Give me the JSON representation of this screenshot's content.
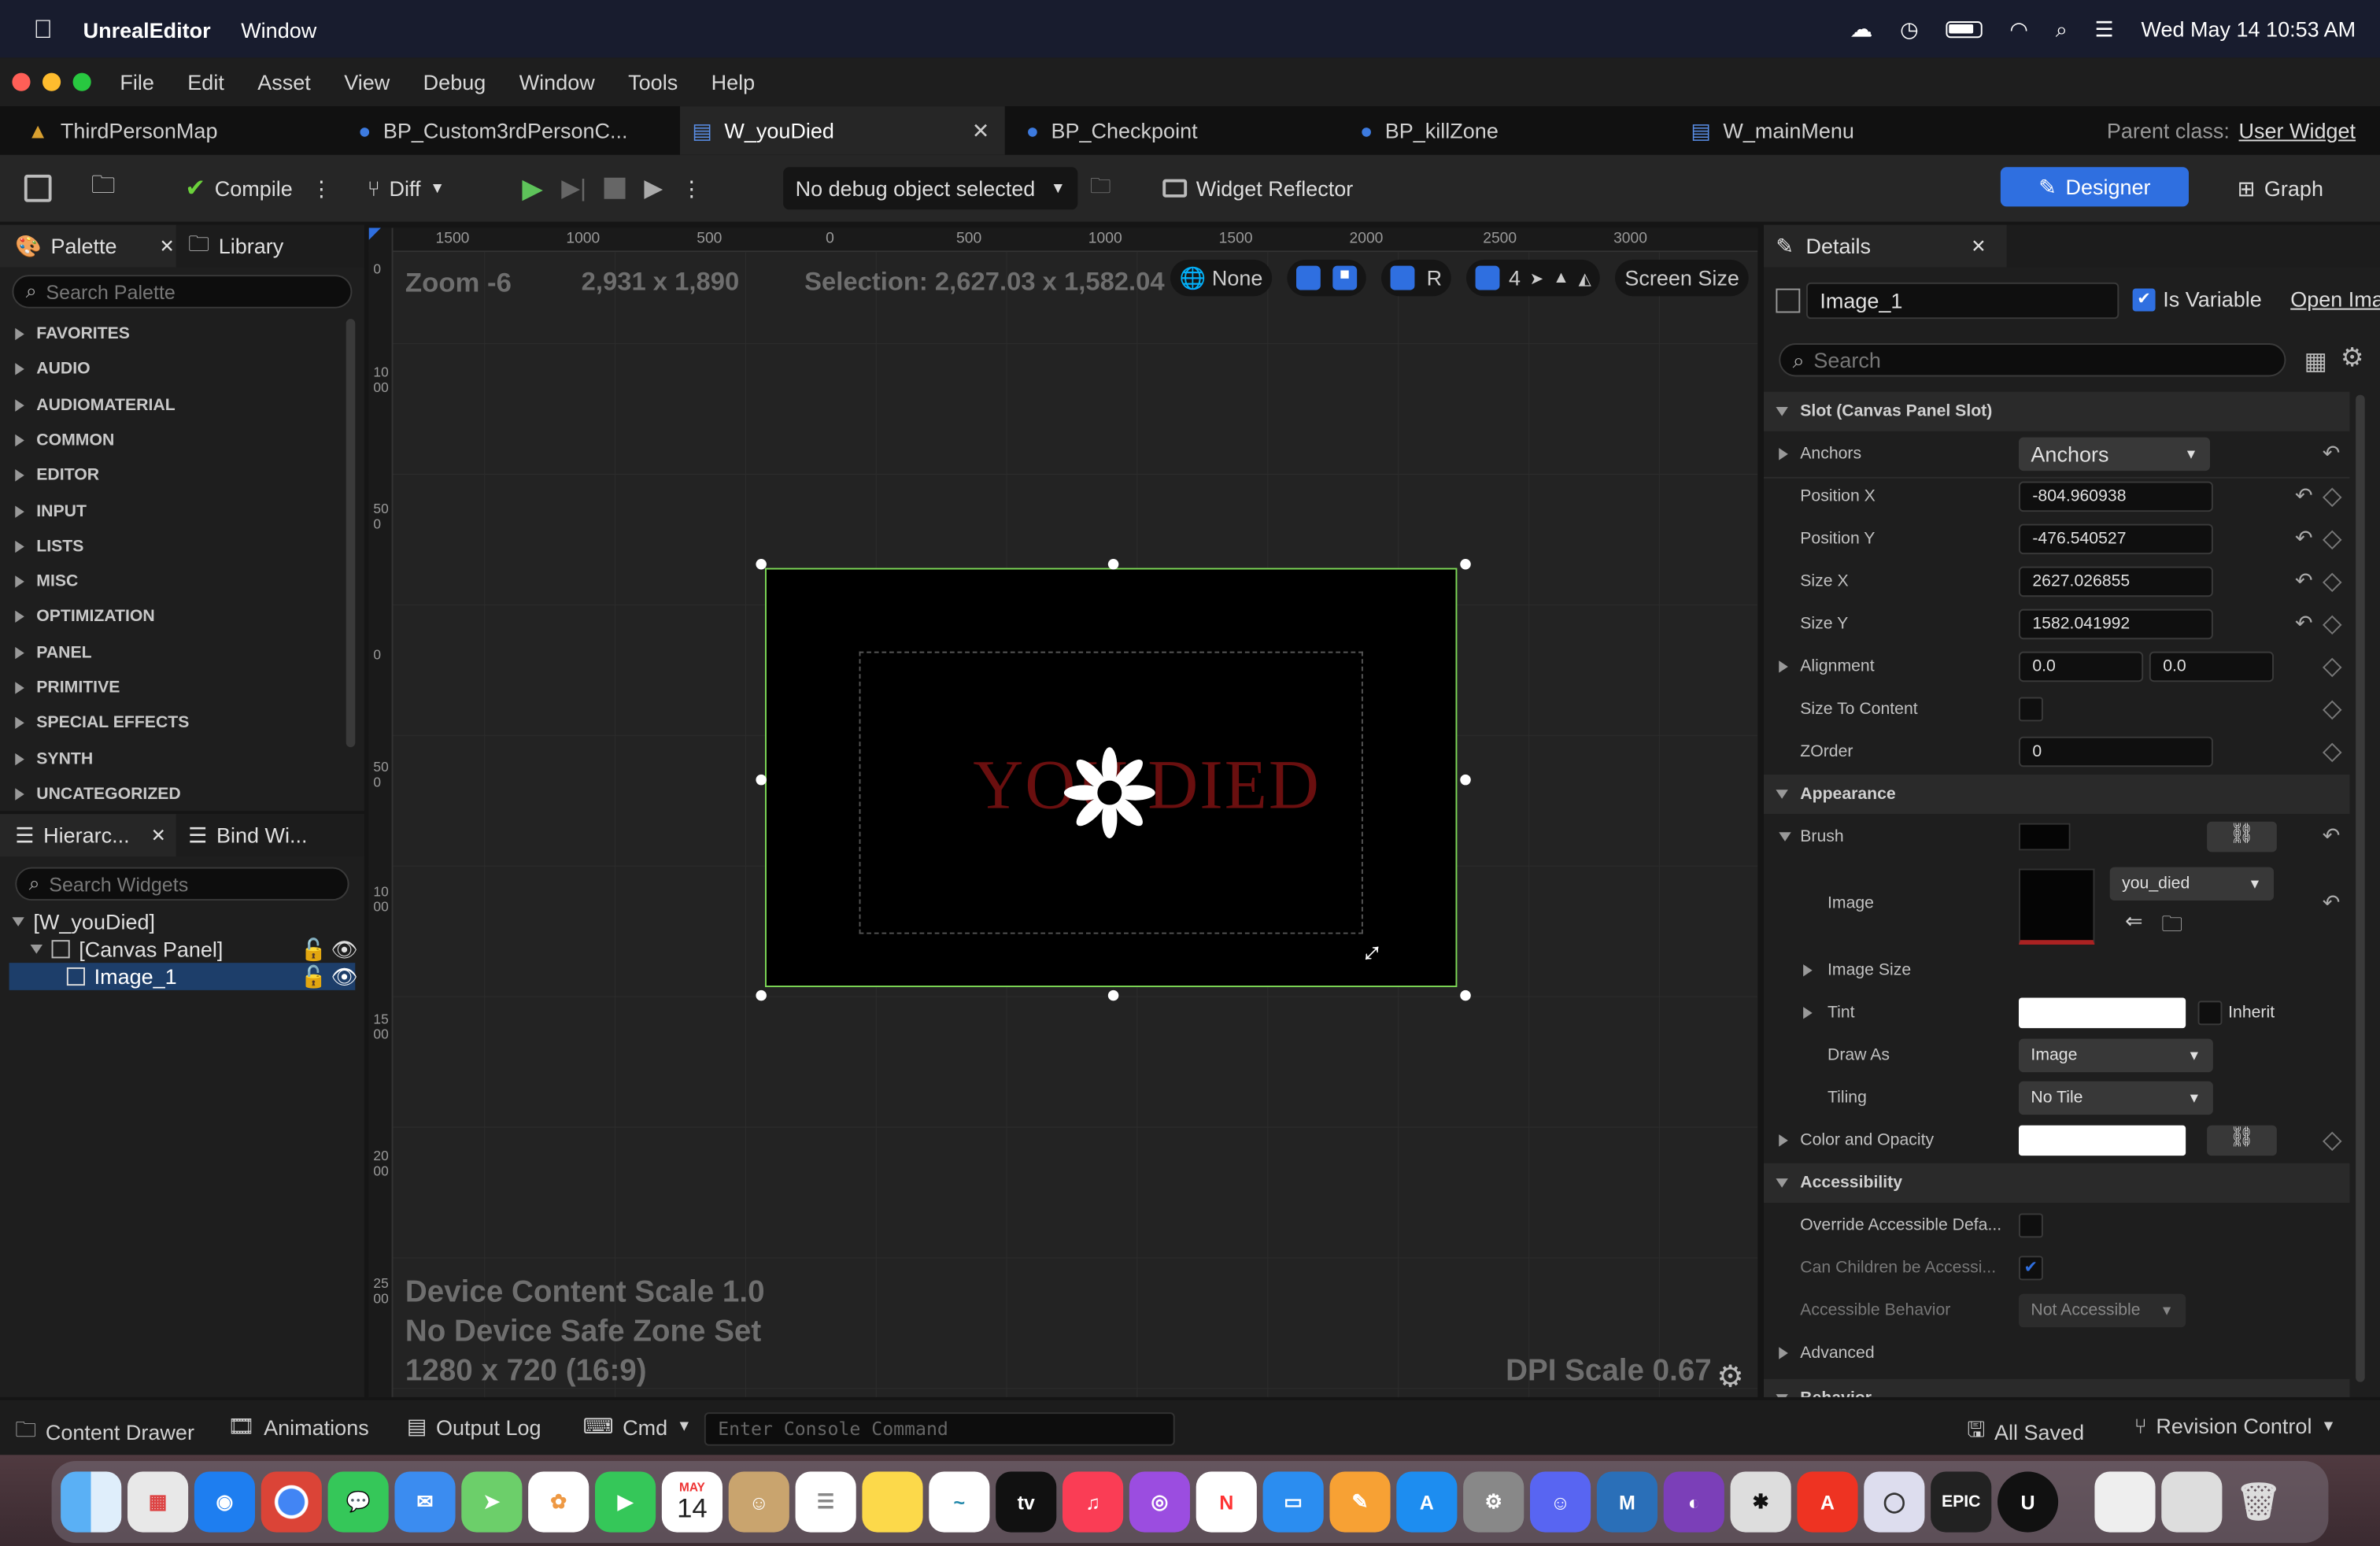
{
  "menubar": {
    "app": "UnrealEditor",
    "window_menu": "Window",
    "datetime": "Wed May 14  10:53 AM"
  },
  "app_menu": [
    "File",
    "Edit",
    "Asset",
    "View",
    "Debug",
    "Window",
    "Tools",
    "Help"
  ],
  "tabs": [
    {
      "label": "ThirdPersonMap"
    },
    {
      "label": "BP_Custom3rdPersonC..."
    },
    {
      "label": "W_youDied"
    },
    {
      "label": "BP_Checkpoint"
    },
    {
      "label": "BP_killZone"
    },
    {
      "label": "W_mainMenu"
    }
  ],
  "parent_class": {
    "label": "Parent class:",
    "value": "User Widget"
  },
  "toolbar": {
    "compile": "Compile",
    "diff": "Diff",
    "debug_object": "No debug object selected",
    "widget_reflector": "Widget Reflector",
    "designer": "Designer",
    "graph": "Graph"
  },
  "palette": {
    "tab": "Palette",
    "library_tab": "Library",
    "search_placeholder": "Search Palette",
    "categories": [
      "FAVORITES",
      "AUDIO",
      "AUDIOMATERIAL",
      "COMMON",
      "EDITOR",
      "INPUT",
      "LISTS",
      "MISC",
      "OPTIMIZATION",
      "PANEL",
      "PRIMITIVE",
      "SPECIAL EFFECTS",
      "SYNTH",
      "UNCATEGORIZED"
    ]
  },
  "hierarchy": {
    "tab": "Hierarc...",
    "bind_tab": "Bind Wi...",
    "search_placeholder": "Search Widgets",
    "root": "[W_youDied]",
    "canvas": "[Canvas Panel]",
    "image": "Image_1"
  },
  "viewport": {
    "ruler_ticks": [
      "1500",
      "1000",
      "500",
      "0",
      "500",
      "1000",
      "1500",
      "2000",
      "2500",
      "3000"
    ],
    "vruler_ticks": [
      "0",
      "1000",
      "500",
      "0",
      "500",
      "1000",
      "1500",
      "2000",
      "2500"
    ],
    "zoom": "Zoom -6",
    "resolution": "2,931 x 1,890",
    "selection": "Selection: 2,627.03 x 1,582.04",
    "none_label": "None",
    "r_label": "R",
    "grid_count": "4",
    "screen_size": "Screen Size",
    "canvas_text": "YOU DIED",
    "device_scale": "Device Content Scale 1.0",
    "safe_zone": "No Device Safe Zone Set",
    "preview_res": "1280 x 720 (16:9)",
    "dpi_scale": "DPI Scale 0.67"
  },
  "details": {
    "tab": "Details",
    "name": "Image_1",
    "is_variable": "Is Variable",
    "open_image": "Open Ima",
    "search_placeholder": "Search",
    "slot_section": "Slot (Canvas Panel Slot)",
    "anchors_label": "Anchors",
    "anchors_value": "Anchors",
    "position_x_label": "Position X",
    "position_x": "-804.960938",
    "position_y_label": "Position Y",
    "position_y": "-476.540527",
    "size_x_label": "Size X",
    "size_x": "2627.026855",
    "size_y_label": "Size Y",
    "size_y": "1582.041992",
    "alignment_label": "Alignment",
    "alignment_x": "0.0",
    "alignment_y": "0.0",
    "size_to_content_label": "Size To Content",
    "zorder_label": "ZOrder",
    "zorder": "0",
    "appearance_section": "Appearance",
    "brush_label": "Brush",
    "image_label": "Image",
    "image_asset": "you_died",
    "image_size_label": "Image Size",
    "tint_label": "Tint",
    "inherit_label": "Inherit",
    "draw_as_label": "Draw As",
    "draw_as": "Image",
    "tiling_label": "Tiling",
    "tiling": "No Tile",
    "color_opacity_label": "Color and Opacity",
    "accessibility_section": "Accessibility",
    "override_label": "Override Accessible Defa...",
    "children_label": "Can Children be Accessi...",
    "behavior_label": "Accessible Behavior",
    "behavior_value": "Not Accessible",
    "advanced_label": "Advanced",
    "behavior_section": "Behavior"
  },
  "bottom": {
    "content_drawer": "Content Drawer",
    "animations": "Animations",
    "output_log": "Output Log",
    "cmd": "Cmd",
    "console_placeholder": "Enter Console Command",
    "all_saved": "All Saved",
    "revision_control": "Revision Control"
  },
  "dock": {
    "calendar_month": "MAY",
    "calendar_day": "14",
    "epic": "EPIC"
  },
  "colors": {
    "accent_blue": "#2f6fe0",
    "selection_green": "#7ed957",
    "you_died_red": "#6a0f0f"
  }
}
